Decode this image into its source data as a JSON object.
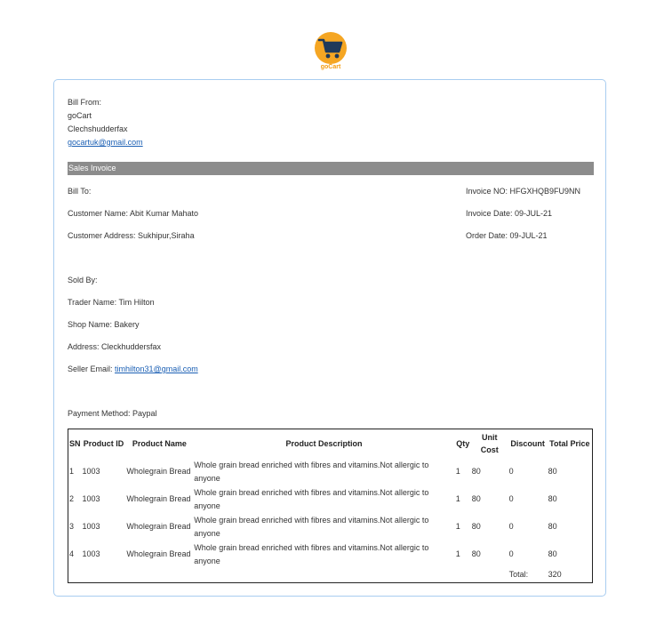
{
  "brand": {
    "logo_text": "goCart"
  },
  "bill_from": {
    "label": "Bill From:",
    "company": "goCart",
    "location": "Clechshudderfax",
    "email": "gocartuk@gmail.com"
  },
  "section_title": "Sales Invoice",
  "bill_to": {
    "label": "Bill To:",
    "customer_name": "Customer Name: Abit Kumar Mahato",
    "customer_address": "Customer Address: Sukhipur,Siraha"
  },
  "invoice_meta": {
    "invoice_no": "Invoice NO: HFGXHQB9FU9NN",
    "invoice_date": "Invoice Date: 09-JUL-21",
    "order_date": "Order Date: 09-JUL-21"
  },
  "sold_by": {
    "label": "Sold By:",
    "trader_name": "Trader Name: Tim Hilton",
    "shop_name": "Shop Name: Bakery",
    "address": "Address: Cleckhuddersfax",
    "seller_email_label": "Seller Email:",
    "seller_email": "timhilton31@gmail.com"
  },
  "payment_method": "Payment Method: Paypal",
  "table": {
    "headers": [
      "SN",
      "Product ID",
      "Product Name",
      "Product Description",
      "Qty",
      "Unit Cost",
      "Discount",
      "Total Price"
    ],
    "rows": [
      [
        "1",
        "1003",
        "Wholegrain Bread",
        "Whole grain bread enriched with fibres and vitamins.Not allergic to anyone",
        "1",
        "80",
        "0",
        "80"
      ],
      [
        "2",
        "1003",
        "Wholegrain Bread",
        "Whole grain bread enriched with fibres and vitamins.Not allergic to anyone",
        "1",
        "80",
        "0",
        "80"
      ],
      [
        "3",
        "1003",
        "Wholegrain Bread",
        "Whole grain bread enriched with fibres and vitamins.Not allergic to anyone",
        "1",
        "80",
        "0",
        "80"
      ],
      [
        "4",
        "1003",
        "Wholegrain Bread",
        "Whole grain bread enriched with fibres and vitamins.Not allergic to anyone",
        "1",
        "80",
        "0",
        "80"
      ]
    ],
    "total_label": "Total:",
    "total_value": "320"
  },
  "colors": {
    "card_border": "#a9cdf0",
    "section_bar": "#8c8c8c",
    "logo_orange": "#f5a623",
    "logo_navy": "#1f3a5a",
    "link": "#1a5fb4"
  }
}
